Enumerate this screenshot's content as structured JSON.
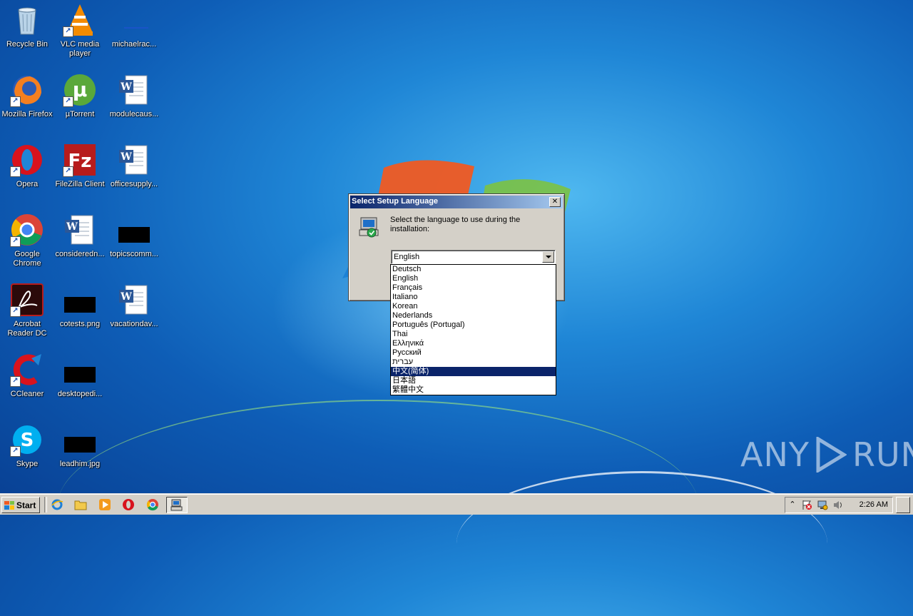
{
  "desktop": {
    "icons": [
      {
        "label": "Recycle Bin",
        "icon": "recycle-bin-icon"
      },
      {
        "label": "VLC media player",
        "icon": "vlc-icon"
      },
      {
        "label": "michaelrac...",
        "icon": "file-icon"
      },
      {
        "label": "Mozilla Firefox",
        "icon": "firefox-icon"
      },
      {
        "label": "µTorrent",
        "icon": "utorrent-icon"
      },
      {
        "label": "modulecaus...",
        "icon": "word-document-icon"
      },
      {
        "label": "Opera",
        "icon": "opera-icon"
      },
      {
        "label": "FileZilla Client",
        "icon": "filezilla-icon"
      },
      {
        "label": "officesupply...",
        "icon": "word-document-icon"
      },
      {
        "label": "Google Chrome",
        "icon": "chrome-icon"
      },
      {
        "label": "consideredn...",
        "icon": "word-document-icon"
      },
      {
        "label": "topicscomm...",
        "icon": "image-file-icon"
      },
      {
        "label": "Acrobat Reader DC",
        "icon": "acrobat-icon"
      },
      {
        "label": "cotests.png",
        "icon": "image-file-icon"
      },
      {
        "label": "vacationdav...",
        "icon": "word-document-icon"
      },
      {
        "label": "CCleaner",
        "icon": "ccleaner-icon"
      },
      {
        "label": "desktopedi...",
        "icon": "image-file-icon"
      },
      {
        "label": "Skype",
        "icon": "skype-icon"
      },
      {
        "label": "leadhim.jpg",
        "icon": "image-file-icon"
      }
    ]
  },
  "dialog": {
    "title": "Select Setup Language",
    "close_glyph": "✕",
    "prompt": "Select the language to use during the installation:",
    "selected_value": "English",
    "options": [
      "Deutsch",
      "English",
      "Français",
      "Italiano",
      "Korean",
      "Nederlands",
      "Português (Portugal)",
      "Thai",
      "Ελληνικά",
      "Русский",
      "עברית",
      "中文(简体)",
      "日本語",
      "繁體中文"
    ],
    "highlighted_option": "中文(简体)"
  },
  "watermark": {
    "left": "ANY",
    "right": "RUN"
  },
  "taskbar": {
    "start_label": "Start",
    "clock": "2:26 AM",
    "tray_expand_glyph": "⌃"
  },
  "colors": {
    "title_bar_start": "#0a246a",
    "title_bar_end": "#a6caf0",
    "selection": "#0a246a",
    "desktop_blue": "#1f86d6"
  }
}
